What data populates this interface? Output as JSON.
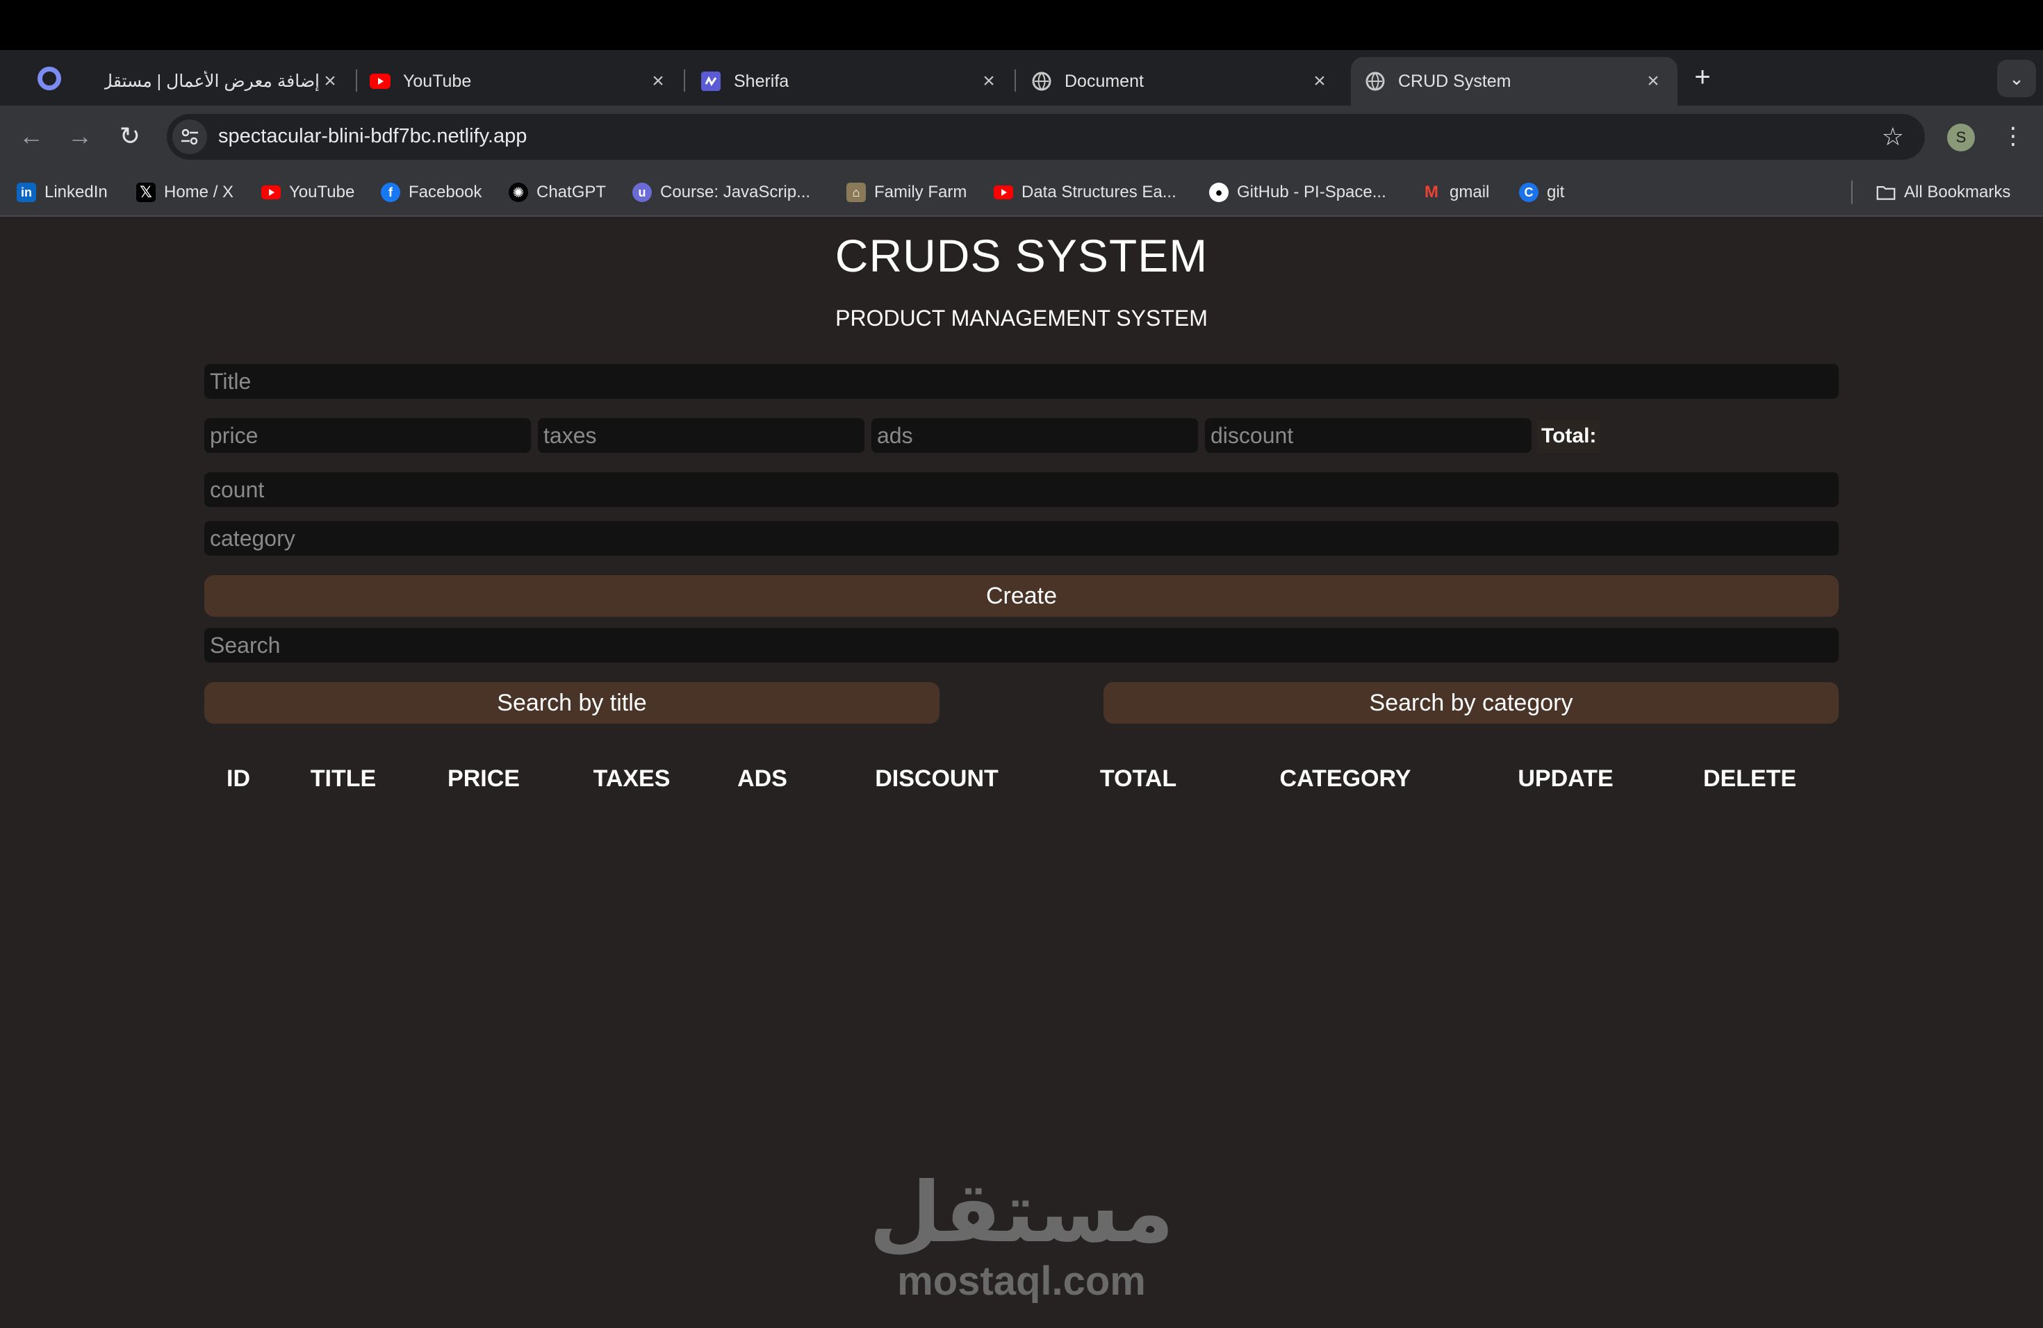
{
  "browser": {
    "tabs": [
      {
        "title": "إضافة معرض الأعمال | مستقل",
        "icon": "mostaql-icon",
        "active": false
      },
      {
        "title": "YouTube",
        "icon": "youtube-icon",
        "active": false
      },
      {
        "title": "Sherifa",
        "icon": "sherifa-icon",
        "active": false
      },
      {
        "title": "Document",
        "icon": "globe-icon",
        "active": false
      },
      {
        "title": "CRUD System",
        "icon": "globe-icon",
        "active": true
      }
    ],
    "new_tab_symbol": "+",
    "url": "spectacular-blini-bdf7bc.netlify.app",
    "avatar_letter": "S",
    "bookmarks": [
      {
        "label": "LinkedIn",
        "icon": "linkedin-icon",
        "color": "#0a66c2"
      },
      {
        "label": "Home / X",
        "icon": "x-icon",
        "color": "#000000"
      },
      {
        "label": "YouTube",
        "icon": "youtube-icon",
        "color": "#ff0000"
      },
      {
        "label": "Facebook",
        "icon": "facebook-icon",
        "color": "#1877f2"
      },
      {
        "label": "ChatGPT",
        "icon": "chatgpt-icon",
        "color": "#000000"
      },
      {
        "label": "Course: JavaScrip...",
        "icon": "course-icon",
        "color": "#6b6bd6"
      },
      {
        "label": "Family Farm",
        "icon": "family-farm-icon",
        "color": "#8a7a5a"
      },
      {
        "label": "Data Structures Ea...",
        "icon": "youtube-icon",
        "color": "#ff0000"
      },
      {
        "label": "GitHub - PI-Space...",
        "icon": "github-icon",
        "color": "#ffffff"
      },
      {
        "label": "gmail",
        "icon": "gmail-icon",
        "color": "#ea4335"
      },
      {
        "label": "git",
        "icon": "git-icon",
        "color": "#1a73e8"
      }
    ],
    "all_bookmarks_label": "All Bookmarks"
  },
  "page": {
    "title": "CRUDS SYSTEM",
    "subtitle": "PRODUCT MANAGEMENT SYSTEM",
    "inputs": {
      "title_placeholder": "Title",
      "price_placeholder": "price",
      "taxes_placeholder": "taxes",
      "ads_placeholder": "ads",
      "discount_placeholder": "discount",
      "count_placeholder": "count",
      "category_placeholder": "category",
      "search_placeholder": "Search"
    },
    "total_label": "Total:",
    "create_label": "Create",
    "search_by_title_label": "Search by title",
    "search_by_category_label": "Search by category",
    "table_headers": [
      "ID",
      "TITLE",
      "PRICE",
      "TAXES",
      "ADS",
      "DISCOUNT",
      "TOTAL",
      "CATEGORY",
      "UPDATE",
      "DELETE"
    ],
    "colors": {
      "background": "#252221",
      "button": "#4a3428",
      "input": "#121212"
    }
  },
  "watermark": {
    "arabic": "مستقل",
    "latin": "mostaql.com"
  }
}
